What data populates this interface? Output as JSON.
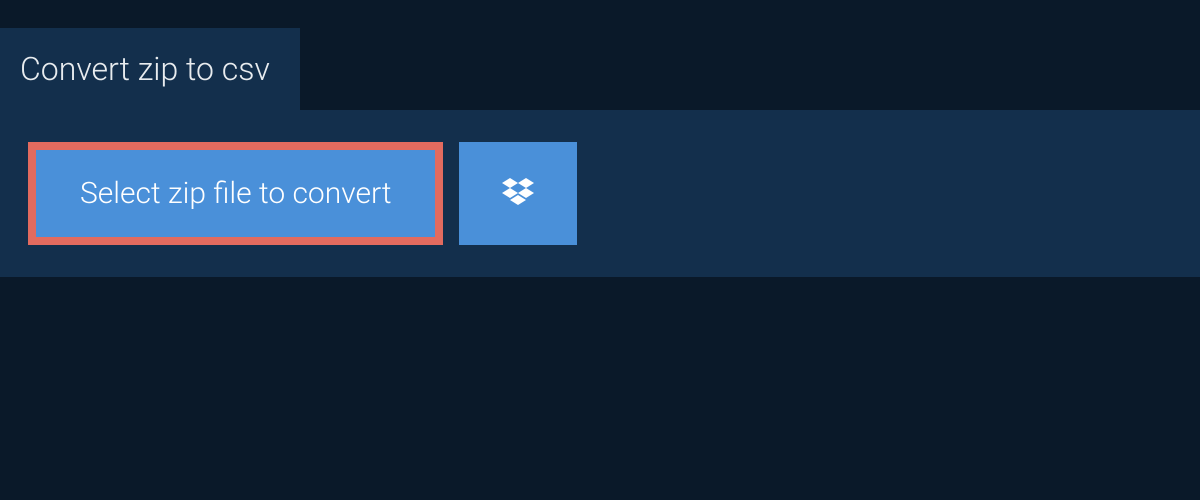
{
  "tab": {
    "title": "Convert zip to csv"
  },
  "actions": {
    "select_file_label": "Select zip file to convert"
  },
  "colors": {
    "background": "#0a1929",
    "panel": "#132f4c",
    "button": "#4a90d9",
    "highlight_border": "#e26b5f",
    "text_light": "#ffffff"
  }
}
